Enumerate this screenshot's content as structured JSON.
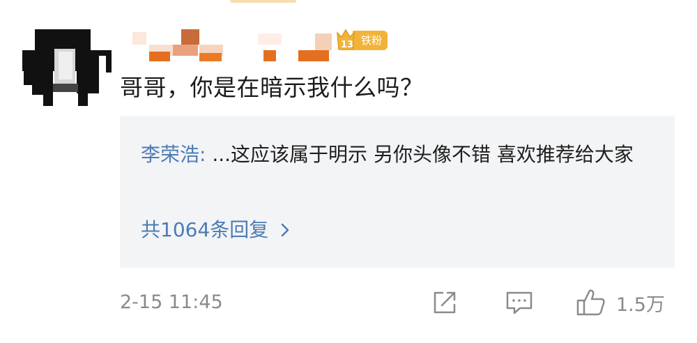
{
  "comment": {
    "fan_badge_label": "铁粉",
    "text": "哥哥，你是在暗示我什么吗？",
    "time": "2-15 11:45",
    "like_count": "1.5万"
  },
  "reply_preview": {
    "user": "李荣浩",
    "separator": ": ",
    "text": "...这应该属于明示 另你头像不错 喜欢推荐给大家",
    "count_label": "共1064条回复"
  },
  "icons": {
    "share": "share-icon",
    "comment": "comment-icon",
    "like": "thumbs-up-icon",
    "badge": "fan-badge-icon",
    "chevron": "chevron-right-icon"
  },
  "colors": {
    "link_blue": "#4c7bb5",
    "badge_gold": "#f2b33b",
    "muted_gray": "#8a8a8a",
    "reply_bg": "#f3f4f6"
  }
}
